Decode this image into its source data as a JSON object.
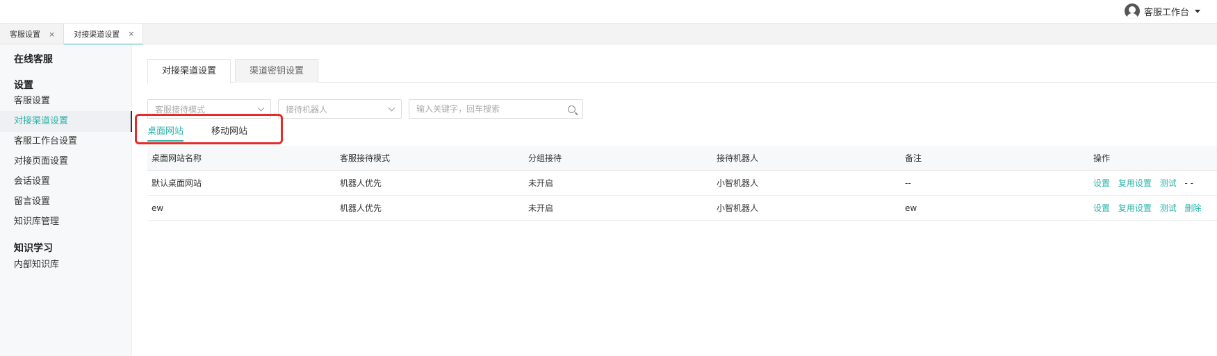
{
  "header": {
    "workbench_label": "客服工作台"
  },
  "page_tabs": [
    {
      "label": "客服设置",
      "close": "×"
    },
    {
      "label": "对接渠道设置",
      "close": "×"
    }
  ],
  "sidebar": {
    "section_online": "在线客服",
    "section_settings": "设置",
    "items": [
      "客服设置",
      "对接渠道设置",
      "客服工作台设置",
      "对接页面设置",
      "会话设置",
      "留言设置",
      "知识库管理"
    ],
    "section_learning": "知识学习",
    "learning_items": [
      "内部知识库"
    ]
  },
  "main": {
    "sub_tabs": [
      "对接渠道设置",
      "渠道密钥设置"
    ],
    "filters": {
      "mode_placeholder": "客服接待模式",
      "robot_placeholder": "接待机器人",
      "search_placeholder": "输入关键字，回车搜索"
    },
    "site_tabs": [
      "桌面网站",
      "移动网站"
    ],
    "table": {
      "columns": [
        "桌面网站名称",
        "客服接待模式",
        "分组接待",
        "接待机器人",
        "备注",
        "操作"
      ],
      "rows": [
        {
          "name": "默认桌面网站",
          "mode": "机器人优先",
          "group": "未开启",
          "robot": "小智机器人",
          "remark": "--",
          "ops": [
            "设置",
            "复用设置",
            "测试"
          ],
          "extra": "- -"
        },
        {
          "name": "ew",
          "mode": "机器人优先",
          "group": "未开启",
          "robot": "小智机器人",
          "remark": "ew",
          "ops": [
            "设置",
            "复用设置",
            "测试",
            "删除"
          ],
          "extra": ""
        }
      ]
    }
  },
  "colors": {
    "accent": "#2bb3a9",
    "highlight_box": "#e62b2b"
  }
}
